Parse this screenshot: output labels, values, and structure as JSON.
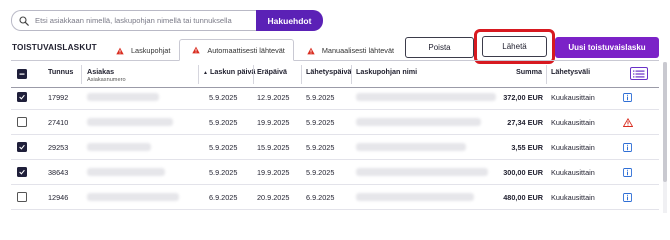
{
  "search": {
    "placeholder": "Etsi asiakkaan nimellä, laskupohjan nimellä tai tunnuksella",
    "button_label": "Hakuehdot"
  },
  "section_title": "TOISTUVAISLASKUT",
  "tabs": [
    {
      "label": "Laskupohjat",
      "icon": "warning-icon",
      "active": false
    },
    {
      "label": "Automaattisesti lähtevät",
      "icon": "warning-icon",
      "active": true
    },
    {
      "label": "Manuaalisesti lähtevät",
      "icon": "warning-icon",
      "active": false
    }
  ],
  "actions": {
    "delete_label": "Poista",
    "send_label": "Lähetä",
    "new_label": "Uusi toistuvaislasku"
  },
  "colors": {
    "brand": "#5b21b6",
    "new_button": "#7b22c7",
    "highlight": "#d71920",
    "warning": "#d92d20",
    "info": "#2f6fd6"
  },
  "table": {
    "headers": {
      "id": "Tunnus",
      "customer": "Asiakas",
      "customer_sub": "Asiakasnumero",
      "invoice_date": "Laskun päivä",
      "invoice_date_sort": "▲",
      "due_date": "Eräpäivä",
      "send_date": "Lähetyspäivä",
      "template_name": "Laskupohjan nimi",
      "amount": "Summa",
      "interval": "Lähetysväli"
    },
    "rows": [
      {
        "checked": true,
        "id": "17992",
        "invoice_date": "5.9.2025",
        "due_date": "12.9.2025",
        "send_date": "5.9.2025",
        "amount": "372,00 EUR",
        "interval": "Kuukausittain",
        "status_icon": "info-icon"
      },
      {
        "checked": false,
        "id": "27410",
        "invoice_date": "5.9.2025",
        "due_date": "19.9.2025",
        "send_date": "5.9.2025",
        "amount": "27,34 EUR",
        "interval": "Kuukausittain",
        "status_icon": "warning-icon"
      },
      {
        "checked": true,
        "id": "29253",
        "invoice_date": "5.9.2025",
        "due_date": "15.9.2025",
        "send_date": "5.9.2025",
        "amount": "3,55 EUR",
        "interval": "Kuukausittain",
        "status_icon": "info-icon"
      },
      {
        "checked": true,
        "id": "38643",
        "invoice_date": "5.9.2025",
        "due_date": "19.9.2025",
        "send_date": "5.9.2025",
        "amount": "300,00 EUR",
        "interval": "Kuukausittain",
        "status_icon": "info-icon"
      },
      {
        "checked": false,
        "id": "12946",
        "invoice_date": "6.9.2025",
        "due_date": "20.9.2025",
        "send_date": "6.9.2025",
        "amount": "480,00 EUR",
        "interval": "Kuukausittain",
        "status_icon": "info-icon"
      }
    ]
  }
}
